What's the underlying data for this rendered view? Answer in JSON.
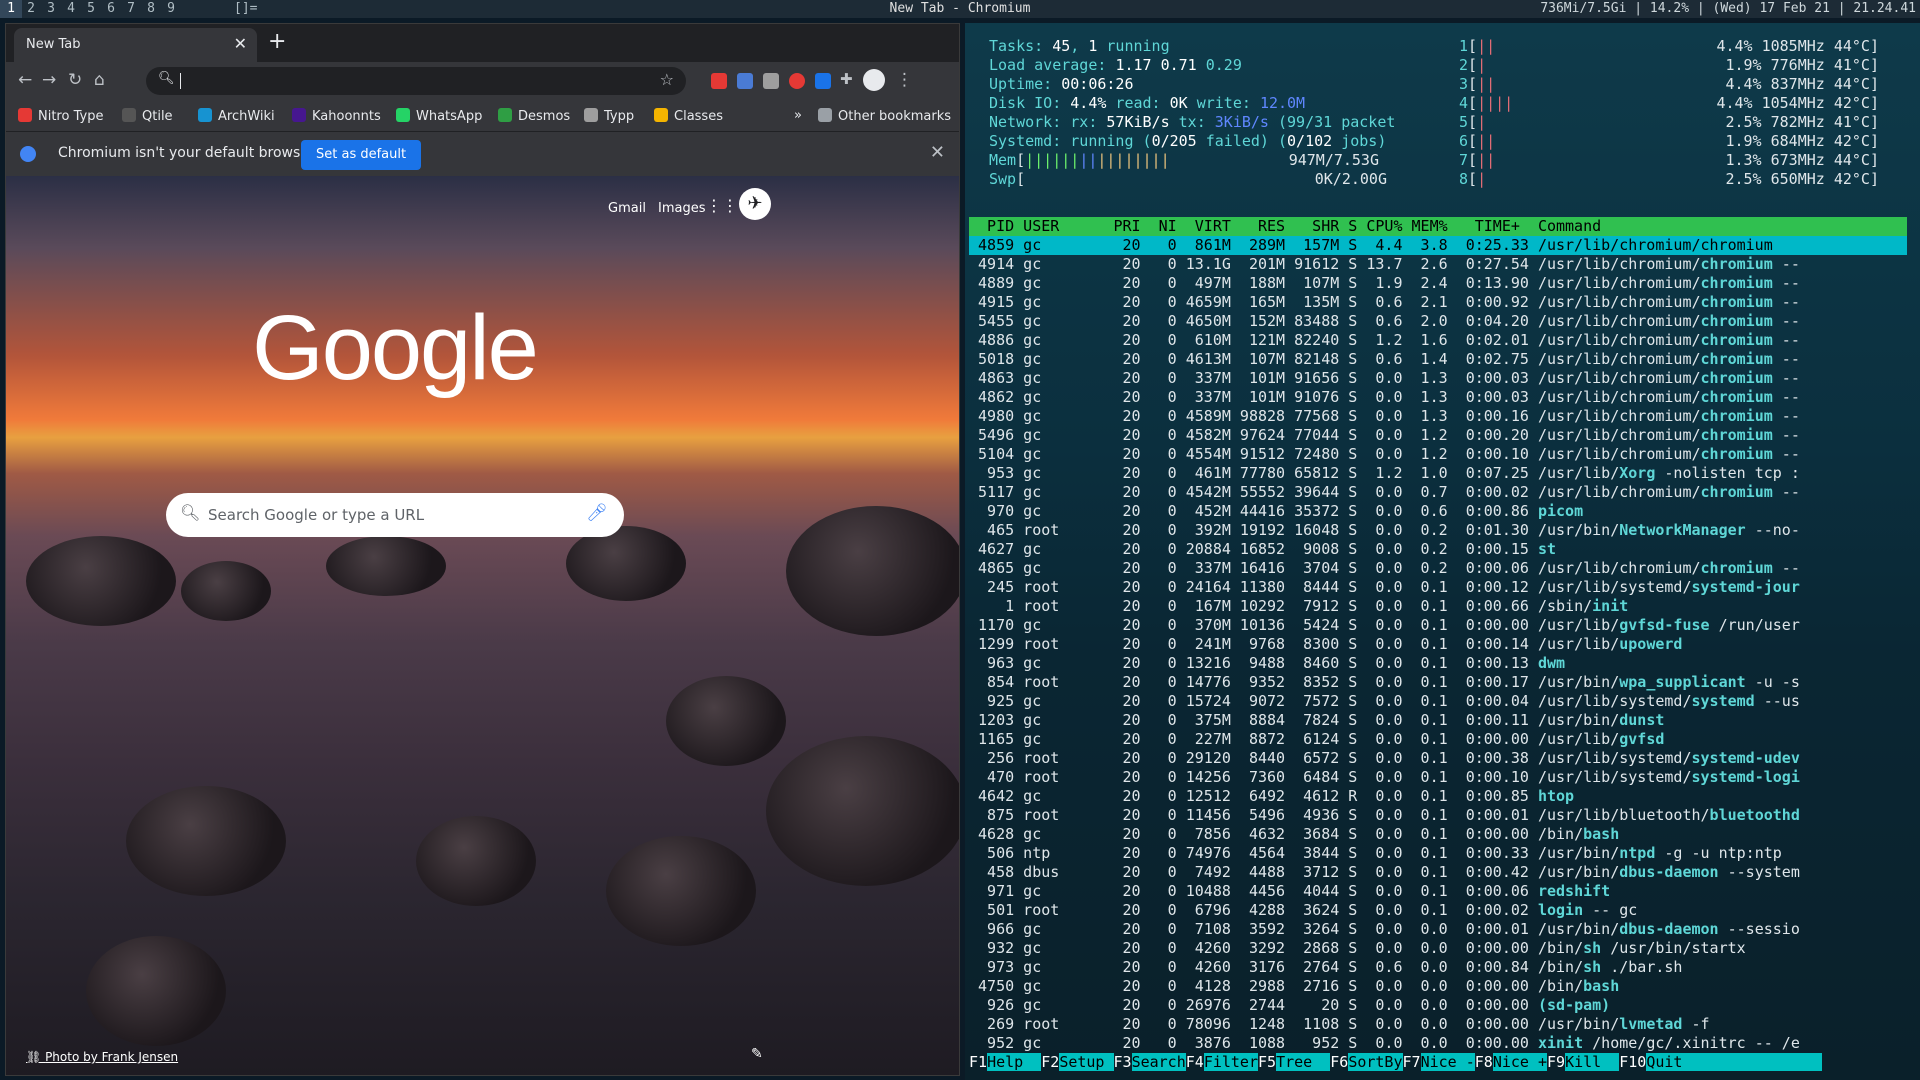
{
  "topbar": {
    "workspaces": [
      "1",
      "2",
      "3",
      "4",
      "5",
      "6",
      "7",
      "8",
      "9"
    ],
    "layout": "[]=",
    "title": "New Tab - Chromium",
    "status": "736Mi/7.5Gi | 14.2% | (Wed) 17 Feb 21 | 21.24.41"
  },
  "browser": {
    "tab_title": "New Tab",
    "tab_close": "✕",
    "new_tab": "+",
    "omnibox_value": "",
    "bookmarks": [
      {
        "label": "Nitro Type",
        "color": "#e53935"
      },
      {
        "label": "Qtile",
        "color": "#555"
      },
      {
        "label": "ArchWiki",
        "color": "#1793d1"
      },
      {
        "label": "Kahoonnts",
        "color": "#46178f"
      },
      {
        "label": "WhatsApp",
        "color": "#25d366"
      },
      {
        "label": "Desmos",
        "color": "#2f9e44"
      },
      {
        "label": "Typp",
        "color": "#9e9e9e"
      },
      {
        "label": "Classes",
        "color": "#f4b400"
      }
    ],
    "bookmarks_more": "»",
    "other_bookmarks": "Other bookmarks",
    "infobar_text": "Chromium isn't your default browser",
    "set_default": "Set as default",
    "gmail": "Gmail",
    "images": "Images",
    "logo": "Google",
    "search_placeholder": "Search Google or type a URL",
    "photo_credit": "Photo by Frank Jensen"
  },
  "htop": {
    "tasks": "45",
    "running": "1",
    "load": [
      "1.17",
      "0.71",
      "0.29"
    ],
    "uptime": "00:06:26",
    "disk_io": "4.4%",
    "disk_read": "0K",
    "disk_write": "12.0M",
    "net_rx": "57KiB/s",
    "net_tx": "3KiB/s",
    "net_packets": "(99/31 packet",
    "systemd": "running",
    "systemd_failed": "0/205",
    "systemd_jobs": "0/102",
    "mem": "947M/7.53G",
    "swp": "0K/2.00G",
    "cpus": [
      {
        "n": "1",
        "pct": "4.4%",
        "mhz": "1085MHz",
        "temp": "44°C"
      },
      {
        "n": "2",
        "pct": "1.9%",
        "mhz": "776MHz",
        "temp": "41°C"
      },
      {
        "n": "3",
        "pct": "4.4%",
        "mhz": "837MHz",
        "temp": "44°C"
      },
      {
        "n": "4",
        "pct": "4.4%",
        "mhz": "1054MHz",
        "temp": "42°C"
      },
      {
        "n": "5",
        "pct": "2.5%",
        "mhz": "782MHz",
        "temp": "41°C"
      },
      {
        "n": "6",
        "pct": "1.9%",
        "mhz": "684MHz",
        "temp": "42°C"
      },
      {
        "n": "7",
        "pct": "1.3%",
        "mhz": "673MHz",
        "temp": "44°C"
      },
      {
        "n": "8",
        "pct": "2.5%",
        "mhz": "650MHz",
        "temp": "42°C"
      }
    ],
    "header": "  PID USER      PRI  NI  VIRT   RES   SHR S CPU% MEM%   TIME+  Command",
    "selected": " 4859 gc         20   0  861M  289M  157M S  4.4  3.8  0:25.33 /usr/lib/chromium/chromium",
    "rows": [
      " 4914 gc         20   0 13.1G  201M 91612 S 13.7  2.6  0:27.54 /usr/lib/chromium/chromium --",
      " 4889 gc         20   0  497M  188M  107M S  1.9  2.4  0:13.90 /usr/lib/chromium/chromium --",
      " 4915 gc         20   0 4659M  165M  135M S  0.6  2.1  0:00.92 /usr/lib/chromium/chromium --",
      " 5455 gc         20   0 4650M  152M 83488 S  0.6  2.0  0:04.20 /usr/lib/chromium/chromium --",
      " 4886 gc         20   0  610M  121M 82240 S  1.2  1.6  0:02.01 /usr/lib/chromium/chromium --",
      " 5018 gc         20   0 4613M  107M 82148 S  0.6  1.4  0:02.75 /usr/lib/chromium/chromium --",
      " 4863 gc         20   0  337M  101M 91656 S  0.0  1.3  0:00.03 /usr/lib/chromium/chromium --",
      " 4862 gc         20   0  337M  101M 91076 S  0.0  1.3  0:00.03 /usr/lib/chromium/chromium --",
      " 4980 gc         20   0 4589M 98828 77568 S  0.0  1.3  0:00.16 /usr/lib/chromium/chromium --",
      " 5496 gc         20   0 4582M 97624 77044 S  0.0  1.2  0:00.20 /usr/lib/chromium/chromium --",
      " 5104 gc         20   0 4554M 91512 72480 S  0.0  1.2  0:00.10 /usr/lib/chromium/chromium --",
      "  953 gc         20   0  461M 77780 65812 S  1.2  1.0  0:07.25 /usr/lib/Xorg -nolisten tcp :",
      " 5117 gc         20   0 4542M 55552 39644 S  0.0  0.7  0:00.02 /usr/lib/chromium/chromium --",
      "  970 gc         20   0  452M 44416 35372 S  0.0  0.6  0:00.86 picom",
      "  465 root       20   0  392M 19192 16048 S  0.0  0.2  0:01.30 /usr/bin/NetworkManager --no-",
      " 4627 gc         20   0 20884 16852  9008 S  0.0  0.2  0:00.15 st",
      " 4865 gc         20   0  337M 16416  3704 S  0.0  0.2  0:00.06 /usr/lib/chromium/chromium --",
      "  245 root       20   0 24164 11380  8444 S  0.0  0.1  0:00.12 /usr/lib/systemd/systemd-jour",
      "    1 root       20   0  167M 10292  7912 S  0.0  0.1  0:00.66 /sbin/init",
      " 1170 gc         20   0  370M 10136  5424 S  0.0  0.1  0:00.00 /usr/lib/gvfsd-fuse /run/user",
      " 1299 root       20   0  241M  9768  8300 S  0.0  0.1  0:00.14 /usr/lib/upowerd",
      "  963 gc         20   0 13216  9488  8460 S  0.0  0.1  0:00.13 dwm",
      "  854 root       20   0 14776  9352  8352 S  0.0  0.1  0:00.17 /usr/bin/wpa_supplicant -u -s",
      "  925 gc         20   0 15724  9072  7572 S  0.0  0.1  0:00.04 /usr/lib/systemd/systemd --us",
      " 1203 gc         20   0  375M  8884  7824 S  0.0  0.1  0:00.11 /usr/bin/dunst",
      " 1165 gc         20   0  227M  8872  6124 S  0.0  0.1  0:00.00 /usr/lib/gvfsd",
      "  256 root       20   0 29120  8440  6572 S  0.0  0.1  0:00.38 /usr/lib/systemd/systemd-udev",
      "  470 root       20   0 14256  7360  6484 S  0.0  0.1  0:00.10 /usr/lib/systemd/systemd-logi",
      " 4642 gc         20   0 12512  6492  4612 R  0.0  0.1  0:00.85 htop",
      "  875 root       20   0 11456  5496  4936 S  0.0  0.1  0:00.01 /usr/lib/bluetooth/bluetoothd",
      " 4628 gc         20   0  7856  4632  3684 S  0.0  0.1  0:00.00 /bin/bash",
      "  506 ntp        20   0 74976  4564  3844 S  0.0  0.1  0:00.33 /usr/bin/ntpd -g -u ntp:ntp",
      "  458 dbus       20   0  7492  4488  3712 S  0.0  0.1  0:00.42 /usr/bin/dbus-daemon --system",
      "  971 gc         20   0 10488  4456  4044 S  0.0  0.1  0:00.06 redshift",
      "  501 root       20   0  6796  4288  3624 S  0.0  0.1  0:00.02 login -- gc",
      "  966 gc         20   0  7108  3592  3264 S  0.0  0.0  0:00.01 /usr/bin/dbus-daemon --sessio",
      "  932 gc         20   0  4260  3292  2868 S  0.0  0.0  0:00.00 /bin/sh /usr/bin/startx",
      "  973 gc         20   0  4260  3176  2764 S  0.6  0.0  0:00.84 /bin/sh ./bar.sh",
      " 4750 gc         20   0  4128  2988  2716 S  0.0  0.0  0:00.00 /bin/bash",
      "  926 gc         20   0 26976  2744    20 S  0.0  0.0  0:00.00 (sd-pam)",
      "  269 root       20   0 78096  1248  1108 S  0.0  0.0  0:00.00 /usr/bin/lvmetad -f",
      "  952 gc         20   0  3876  1088   952 S  0.0  0.0  0:00.00 xinit /home/gc/.xinitrc -- /e"
    ],
    "fkeys": [
      {
        "k": "F1",
        "l": "Help  "
      },
      {
        "k": "F2",
        "l": "Setup "
      },
      {
        "k": "F3",
        "l": "Search"
      },
      {
        "k": "F4",
        "l": "Filter"
      },
      {
        "k": "F5",
        "l": "Tree  "
      },
      {
        "k": "F6",
        "l": "SortBy"
      },
      {
        "k": "F7",
        "l": "Nice -"
      },
      {
        "k": "F8",
        "l": "Nice +"
      },
      {
        "k": "F9",
        "l": "Kill  "
      },
      {
        "k": "F10",
        "l": "Quit"
      }
    ]
  }
}
